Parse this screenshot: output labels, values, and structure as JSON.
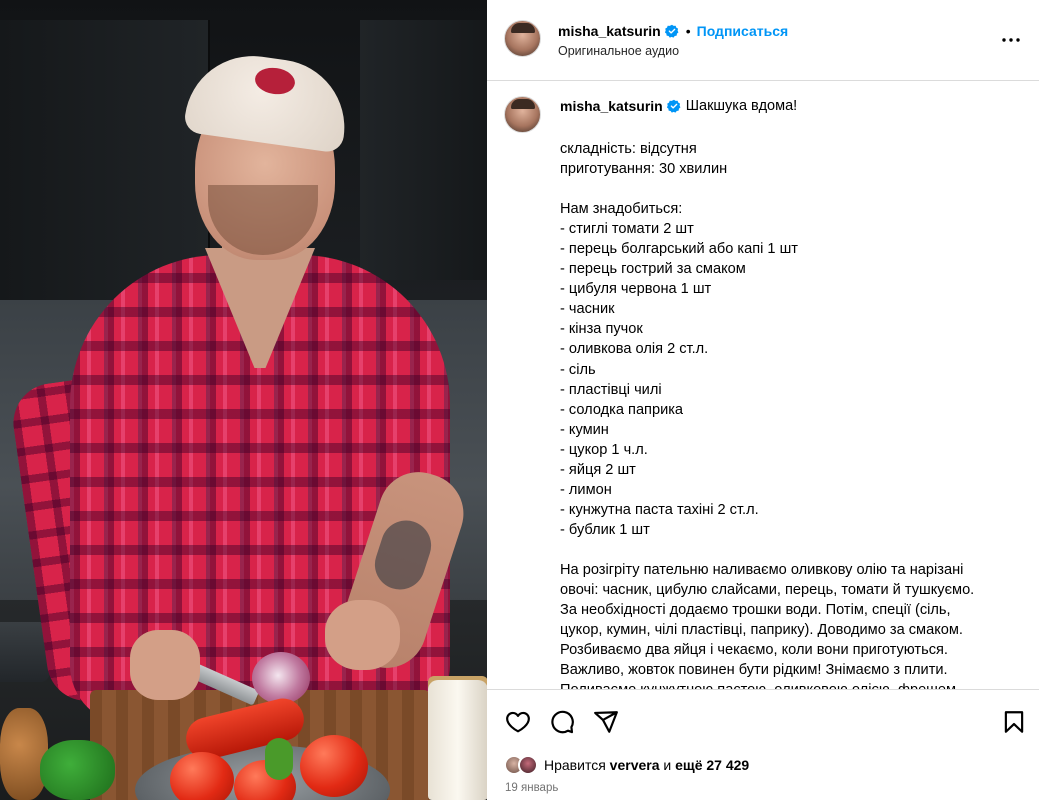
{
  "post": {
    "username": "misha_katsurin",
    "follow_label": "Подписаться",
    "separator": "•",
    "audio_label": "Оригинальное аудио"
  },
  "caption": {
    "username": "misha_katsurin",
    "title": "Шакшука вдома!",
    "lines": [
      "складність: відсутня",
      "приготування: 30 хвилин",
      "",
      "Нам знадобиться:",
      "- стиглі томати 2 шт",
      "- перець болгарський або капі 1 шт",
      "- перець гострий за смаком",
      "- цибуля червона 1 шт",
      "- часник",
      "- кінза пучок",
      "- оливкова олія 2 ст.л.",
      "- сіль",
      "- пластівці чилі",
      "- солодка паприка",
      "- кумин",
      "- цукор 1 ч.л.",
      "- яйця 2 шт",
      "- лимон",
      "- кунжутна паста тахіні 2 ст.л.",
      "- бублик 1 шт",
      ""
    ],
    "paragraph_lines": [
      "На розігріту пательню наливаємо оливкову олію та нарізані",
      "овочі: часник, цибулю слайсами, перець, томати й тушкуємо.",
      "За необхідності додаємо трошки води. Потім, спеції (сіль,",
      "цукор, кумин, чілі пластівці, паприку). Доводимо за смаком.",
      "Розбиваємо два яйця і чекаємо, коли вони приготуються.",
      "Важливо, жовток повинен бути рідким! Знімаємо з плити.",
      "Поливаємо кунжутною пастою, оливковою олією, фрешем"
    ]
  },
  "actions": {
    "likes_prefix": "Нравится",
    "likes_user": "ververa",
    "likes_middle": "и",
    "likes_count": "ещё 27 429",
    "date": "19 январь"
  },
  "colors": {
    "accent": "#0095f6",
    "verified": "#0095f6",
    "secondary_text": "#737373",
    "border": "#dbdbdb"
  },
  "icons": [
    "verified-badge-icon",
    "more-options-icon",
    "heart-icon",
    "comment-icon",
    "share-icon",
    "bookmark-icon"
  ]
}
